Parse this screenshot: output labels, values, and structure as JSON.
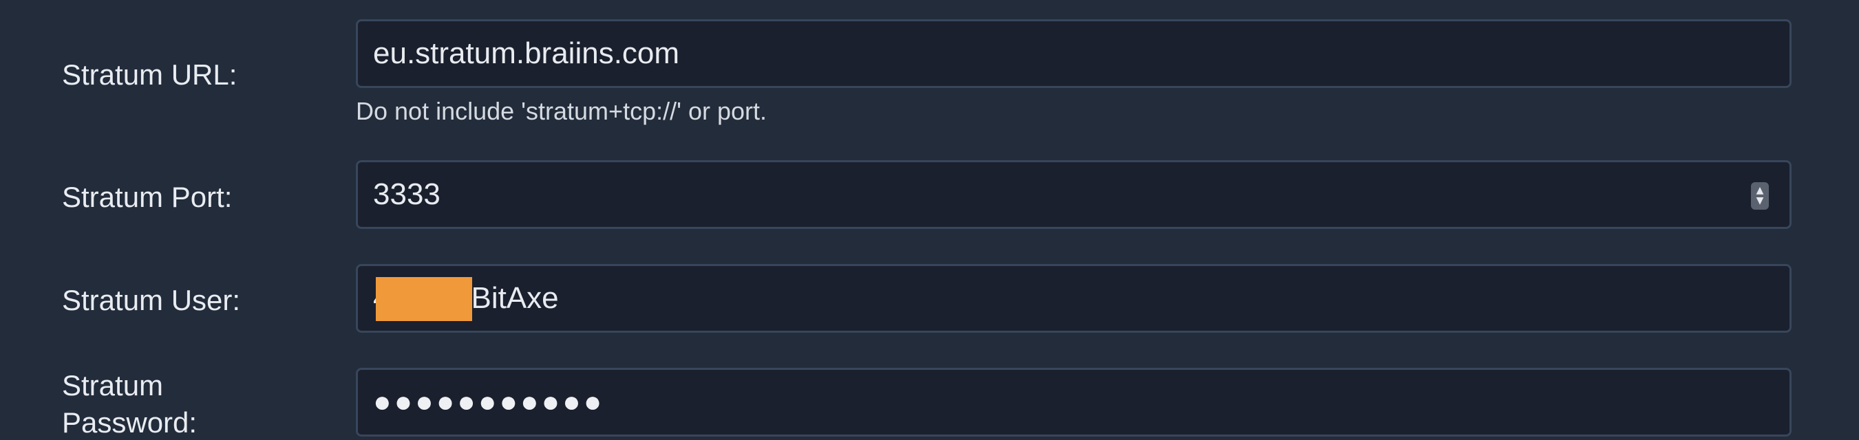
{
  "form": {
    "url": {
      "label": "Stratum URL:",
      "value": "eu.stratum.braiins.com",
      "help": "Do not include 'stratum+tcp://' or port."
    },
    "port": {
      "label": "Stratum Port:",
      "value": "3333",
      "spinner_up": "▲",
      "spinner_down": "▼"
    },
    "user": {
      "label": "Stratum User:",
      "visible_prefix": "4",
      "visible_suffix": "BitAxe",
      "redaction_color": "#f0993a"
    },
    "password": {
      "label_line1": "Stratum",
      "label_line2": "Password:",
      "masked_value": "●●●●●●●●●●●"
    }
  }
}
